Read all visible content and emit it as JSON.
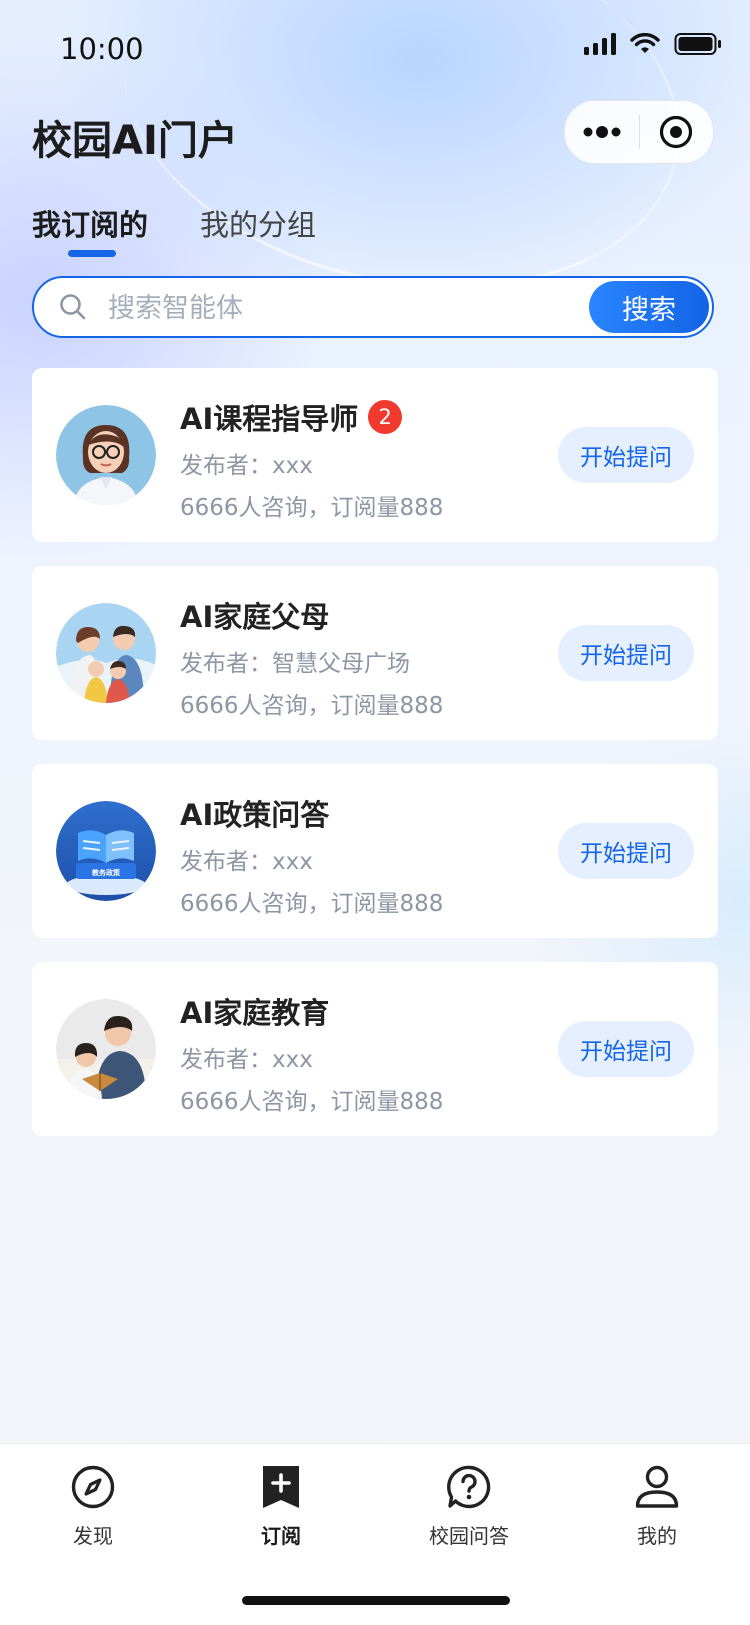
{
  "status_bar": {
    "time": "10:00"
  },
  "header": {
    "title": "校园AI门户"
  },
  "tabs": [
    {
      "label": "我订阅的",
      "active": true
    },
    {
      "label": "我的分组",
      "active": false
    }
  ],
  "search": {
    "placeholder": "搜索智能体",
    "value": "",
    "button_label": "搜索"
  },
  "agents": [
    {
      "name": "AI课程指导师",
      "badge": "2",
      "publisher": "发布者：xxx",
      "stats": "6666人咨询，订阅量888",
      "action_label": "开始提问",
      "avatar_icon": "teacher-avatar"
    },
    {
      "name": "AI家庭父母",
      "badge": "",
      "publisher": "发布者：智慧父母广场",
      "stats": "6666人咨询，订阅量888",
      "action_label": "开始提问",
      "avatar_icon": "family-avatar"
    },
    {
      "name": "AI政策问答",
      "badge": "",
      "publisher": "发布者：xxx",
      "stats": "6666人咨询，订阅量888",
      "action_label": "开始提问",
      "avatar_icon": "book-avatar",
      "avatar_caption": "教务政策"
    },
    {
      "name": "AI家庭教育",
      "badge": "",
      "publisher": "发布者：xxx",
      "stats": "6666人咨询，订阅量888",
      "action_label": "开始提问",
      "avatar_icon": "parent-reading-avatar"
    }
  ],
  "tabbar": [
    {
      "label": "发现",
      "icon": "compass-icon",
      "active": false
    },
    {
      "label": "订阅",
      "icon": "bookmark-plus-icon",
      "active": true
    },
    {
      "label": "校园问答",
      "icon": "question-icon",
      "active": false
    },
    {
      "label": "我的",
      "icon": "user-icon",
      "active": false
    }
  ],
  "colors": {
    "accent": "#1565e8",
    "badge": "#f03a2e",
    "button_bg": "#e5efff"
  }
}
